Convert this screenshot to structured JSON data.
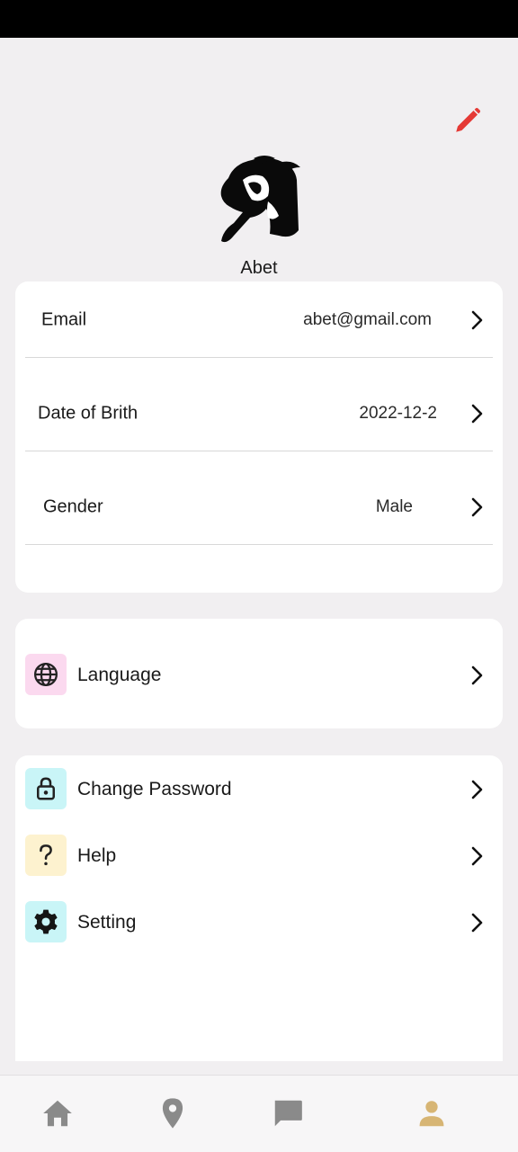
{
  "profile": {
    "name": "Abet"
  },
  "info": {
    "email": {
      "label": "Email",
      "value": "abet@gmail.com"
    },
    "dob": {
      "label": "Date of Brith",
      "value": "2022-12-2"
    },
    "gender": {
      "label": "Gender",
      "value": "Male"
    }
  },
  "menu": {
    "language": {
      "label": "Language",
      "icon": "globe-icon",
      "icon_bg": "#fbd9ef"
    },
    "change_password": {
      "label": "Change Password",
      "icon": "lock-icon",
      "icon_bg": "#c9f5f7"
    },
    "help": {
      "label": "Help",
      "icon": "question-icon",
      "icon_bg": "#fdf2cf"
    },
    "setting": {
      "label": "Setting",
      "icon": "gear-icon",
      "icon_bg": "#c9f5f7"
    }
  },
  "nav": {
    "items": [
      "home-icon",
      "location-pin-icon",
      "chat-icon",
      "person-icon"
    ],
    "active": "person-icon",
    "active_color": "#d7b574",
    "inactive_color": "#8a8a8a"
  },
  "colors": {
    "edit_icon": "#e53935",
    "background": "#f1eff1"
  }
}
